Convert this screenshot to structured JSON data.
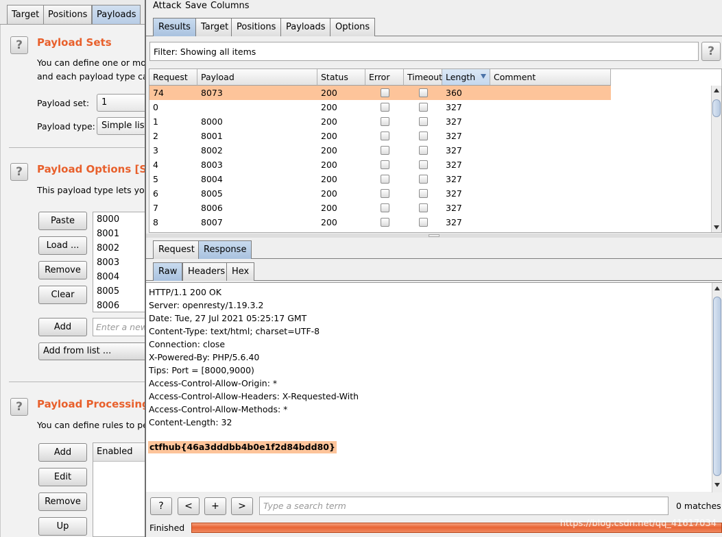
{
  "background": {
    "tabs": [
      "Target",
      "Positions",
      "Payloads"
    ],
    "active_tab": "Payloads",
    "payload_sets": {
      "title": "Payload Sets",
      "desc_line1": "You can define one or more",
      "desc_line2": "and each payload type can",
      "set_label": "Payload set:",
      "set_value": "1",
      "type_label": "Payload type:",
      "type_value": "Simple list"
    },
    "payload_options": {
      "title": "Payload Options [Simp",
      "desc": "This payload type lets you",
      "buttons": [
        "Paste",
        "Load ...",
        "Remove",
        "Clear"
      ],
      "list": [
        "8000",
        "8001",
        "8002",
        "8003",
        "8004",
        "8005",
        "8006"
      ],
      "add_label": "Add",
      "add_placeholder": "Enter a new",
      "add_from_list": "Add from list ..."
    },
    "payload_processing": {
      "title": "Payload Processing",
      "desc": "You can define rules to perf",
      "buttons": [
        "Add",
        "Edit",
        "Remove",
        "Up"
      ],
      "col_enabled": "Enabled"
    }
  },
  "attack": {
    "menu": [
      "Attack",
      "Save",
      "Columns"
    ],
    "tabs": [
      "Results",
      "Target",
      "Positions",
      "Payloads",
      "Options"
    ],
    "filter_text": "Filter: Showing all items",
    "help": "?",
    "columns": [
      "Request",
      "Payload",
      "Status",
      "Error",
      "Timeout",
      "Length",
      "Comment"
    ],
    "rows": [
      {
        "request": "74",
        "payload": "8073",
        "status": "200",
        "length": "360"
      },
      {
        "request": "0",
        "payload": "",
        "status": "200",
        "length": "327"
      },
      {
        "request": "1",
        "payload": "8000",
        "status": "200",
        "length": "327"
      },
      {
        "request": "2",
        "payload": "8001",
        "status": "200",
        "length": "327"
      },
      {
        "request": "3",
        "payload": "8002",
        "status": "200",
        "length": "327"
      },
      {
        "request": "4",
        "payload": "8003",
        "status": "200",
        "length": "327"
      },
      {
        "request": "5",
        "payload": "8004",
        "status": "200",
        "length": "327"
      },
      {
        "request": "6",
        "payload": "8005",
        "status": "200",
        "length": "327"
      },
      {
        "request": "7",
        "payload": "8006",
        "status": "200",
        "length": "327"
      },
      {
        "request": "8",
        "payload": "8007",
        "status": "200",
        "length": "327"
      }
    ],
    "detail_tabs": [
      "Request",
      "Response"
    ],
    "view_tabs": [
      "Raw",
      "Headers",
      "Hex"
    ],
    "response_lines": [
      "HTTP/1.1 200 OK",
      "Server: openresty/1.19.3.2",
      "Date: Tue, 27 Jul 2021 05:25:17 GMT",
      "Content-Type: text/html; charset=UTF-8",
      "Connection: close",
      "X-Powered-By: PHP/5.6.40",
      "Tips: Port = [8000,9000)",
      "Access-Control-Allow-Origin: *",
      "Access-Control-Allow-Headers: X-Requested-With",
      "Access-Control-Allow-Methods: *",
      "Content-Length: 32"
    ],
    "flag": "ctfhub{46a3dddbb4b0e1f2d84bdd80}",
    "search": {
      "help": "?",
      "prev": "<",
      "add": "+",
      "next": ">",
      "placeholder": "Type a search term",
      "matches": "0 matches"
    },
    "status": "Finished",
    "progress": 1.0,
    "watermark": "https://blog.csdn.net/qq_41617034"
  },
  "colors": {
    "accent_orange": "#e8602c",
    "selected_row": "#fdc49a",
    "active_tab": "#b8cde6"
  }
}
